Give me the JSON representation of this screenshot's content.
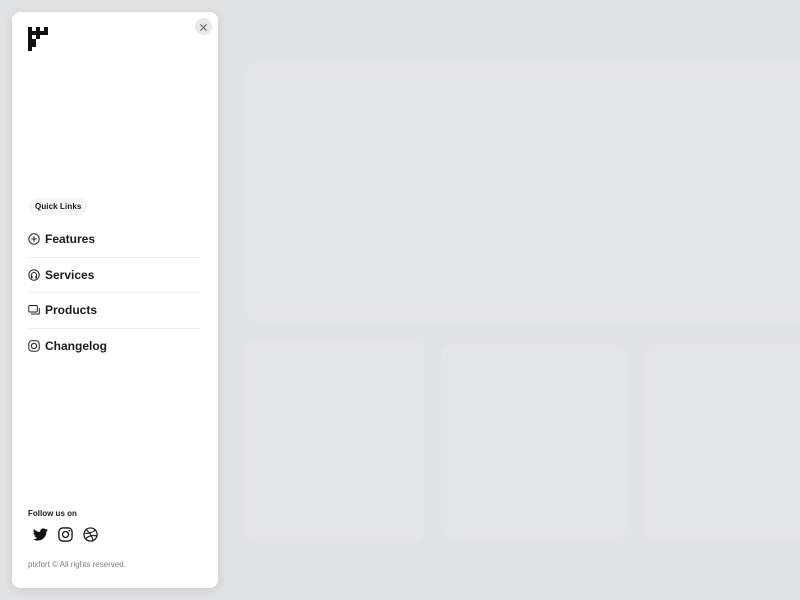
{
  "drawer": {
    "logo_icon": "castle-logo-icon",
    "close_icon": "close-icon",
    "section_label": "Quick Links",
    "menu": [
      {
        "label": "Features",
        "icon": "plus-circle-icon"
      },
      {
        "label": "Services",
        "icon": "support-icon"
      },
      {
        "label": "Products",
        "icon": "chat-icon"
      },
      {
        "label": "Changelog",
        "icon": "changelog-icon"
      }
    ],
    "follow_label": "Follow us on",
    "socials": [
      {
        "name": "twitter",
        "icon": "twitter-icon"
      },
      {
        "name": "instagram",
        "icon": "instagram-icon"
      },
      {
        "name": "dribbble",
        "icon": "dribbble-icon"
      }
    ],
    "copyright": "pixfort © All rights reserved."
  },
  "colors": {
    "backdrop": "#e1e2e4",
    "panel": "#ffffff",
    "text": "#1b1b1b",
    "muted": "#7c7f84"
  }
}
